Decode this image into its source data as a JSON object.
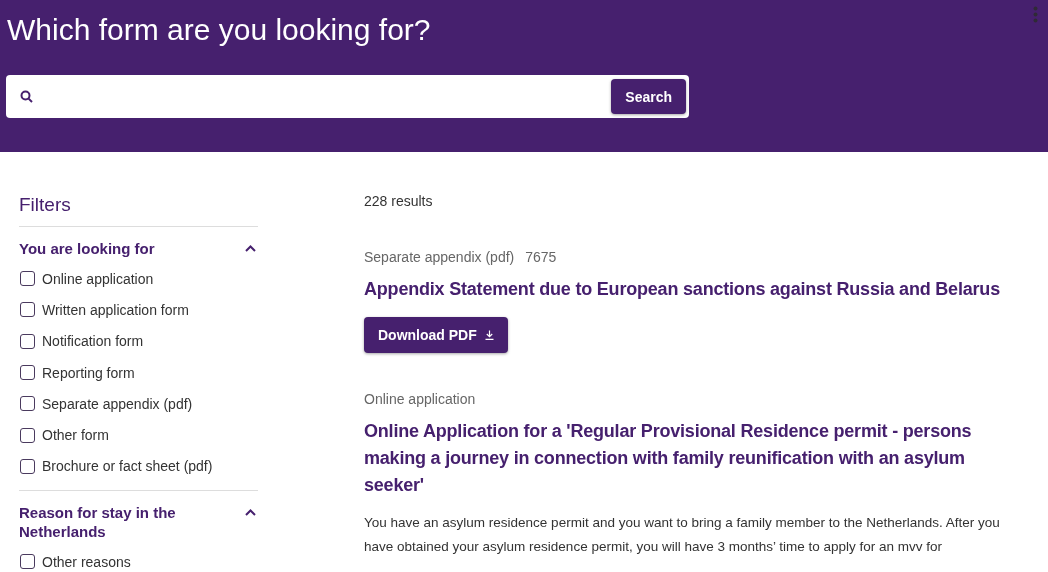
{
  "header": {
    "title": "Which form are you looking for?",
    "search_button": "Search"
  },
  "filters": {
    "title": "Filters",
    "groups": [
      {
        "title": "You are looking for",
        "expanded": true,
        "options": [
          {
            "label": "Online application",
            "checked": false
          },
          {
            "label": "Written application form",
            "checked": false
          },
          {
            "label": "Notification form",
            "checked": false
          },
          {
            "label": "Reporting form",
            "checked": false
          },
          {
            "label": "Separate appendix (pdf)",
            "checked": false
          },
          {
            "label": "Other form",
            "checked": false
          },
          {
            "label": "Brochure or fact sheet (pdf)",
            "checked": false
          }
        ]
      },
      {
        "title": "Reason for stay in the Netherlands",
        "expanded": true,
        "options": [
          {
            "label": "Other reasons",
            "checked": false
          }
        ]
      }
    ]
  },
  "results": {
    "count": "228 results",
    "items": [
      {
        "kind": "download",
        "category": "Separate appendix (pdf)",
        "number": "7675",
        "title": "Appendix Statement due to European sanctions against Russia and Belarus",
        "button": "Download PDF"
      },
      {
        "kind": "summary",
        "category": "Online application",
        "title": "Online Application for a 'Regular Provisional Residence permit - persons making a journey in connection with family reunification with an asylum seeker'",
        "description": "You have an asylum residence permit and you want to bring a family member to the Netherlands. After you have obtained your asylum residence permit, you will have 3 months’ time to apply for an mvv for"
      }
    ]
  }
}
